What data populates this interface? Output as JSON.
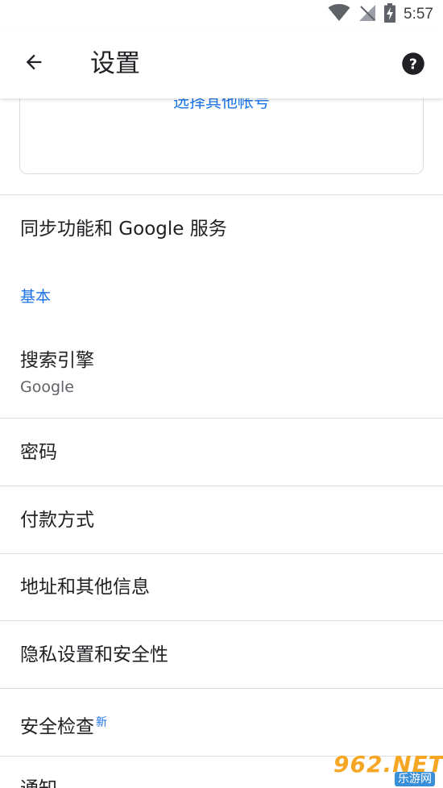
{
  "status_bar": {
    "time": "5:57"
  },
  "app_bar": {
    "title": "设置"
  },
  "account_card": {
    "other_account_label": "选择其他帐号"
  },
  "sync": {
    "label": "同步功能和 Google 服务"
  },
  "section": {
    "basic_label": "基本"
  },
  "items": [
    {
      "label": "搜索引擎",
      "sub": "Google"
    },
    {
      "label": "密码"
    },
    {
      "label": "付款方式"
    },
    {
      "label": "地址和其他信息"
    },
    {
      "label": "隐私设置和安全性"
    },
    {
      "label": "安全检查",
      "badge": "新"
    },
    {
      "label": "通知"
    }
  ],
  "watermark": {
    "brand": "962.NET",
    "site": "乐游网"
  },
  "colors": {
    "accent": "#1a73e8",
    "divider": "#dadce0",
    "text": "#202124",
    "secondary": "#5f6368"
  },
  "icons": {
    "back": "arrow-back-icon",
    "help": "help-circle-icon",
    "wifi": "wifi-icon",
    "signal": "no-signal-icon",
    "battery": "battery-charging-icon"
  }
}
